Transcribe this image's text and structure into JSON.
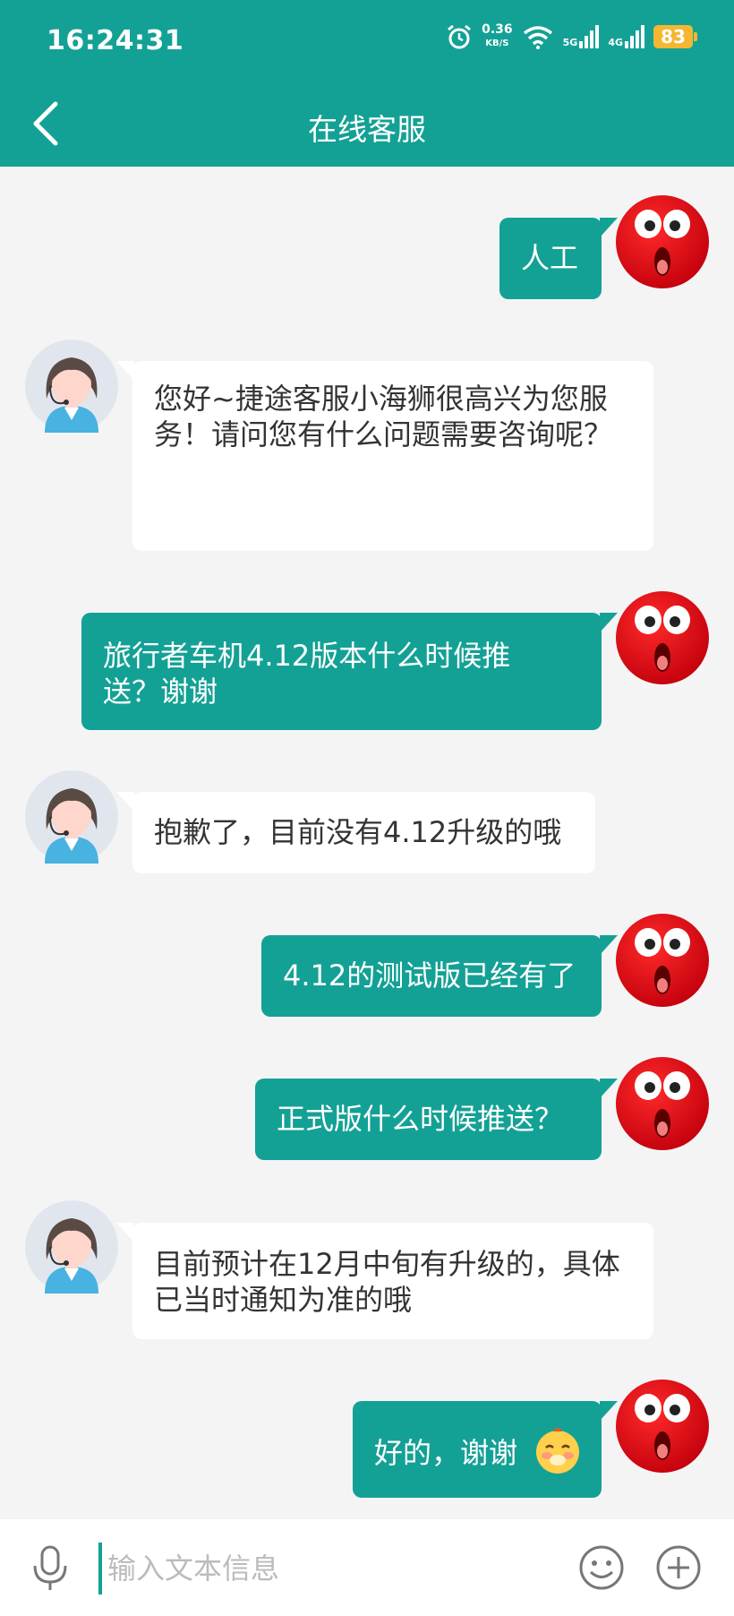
{
  "status": {
    "time": "16:24:31",
    "speed_value": "0.36",
    "speed_unit": "KB/S",
    "signal_5g": "5G",
    "signal_4g": "4G",
    "battery": "83"
  },
  "header": {
    "title": "在线客服"
  },
  "messages": [
    {
      "from": "user",
      "text": "人工"
    },
    {
      "from": "agent",
      "text": "您好~捷途客服小海狮很高兴为您服务！请问您有什么问题需要咨询呢？"
    },
    {
      "from": "user",
      "text": "旅行者车机4.12版本什么时候推送？谢谢"
    },
    {
      "from": "agent",
      "text": "抱歉了，目前没有4.12升级的哦"
    },
    {
      "from": "user",
      "text": "4.12的测试版已经有了"
    },
    {
      "from": "user",
      "text": "正式版什么时候推送？"
    },
    {
      "from": "agent",
      "text": "目前预计在12月中旬有升级的，具体已当时通知为准的哦"
    },
    {
      "from": "user",
      "text": "好的，谢谢"
    }
  ],
  "input": {
    "placeholder": "输入文本信息"
  },
  "icons": {
    "back": "chevron-left-icon",
    "mic": "microphone-icon",
    "emoji": "smiley-icon",
    "plus": "plus-circle-icon",
    "user_avatar": "red-face-avatar",
    "agent_avatar": "agent-headset-avatar",
    "message_emoji": "blushing-emoji"
  },
  "colors": {
    "accent": "#14a195",
    "user_avatar": "#e20a17",
    "battery": "#f5b731"
  }
}
